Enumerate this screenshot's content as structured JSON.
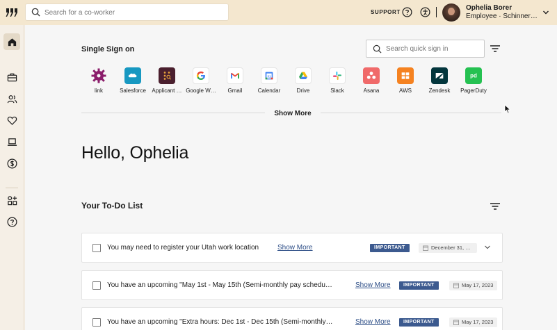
{
  "topbar": {
    "search_placeholder": "Search for a co-worker",
    "support_label": "SUPPORT",
    "user_name": "Ophelia Borer",
    "user_role": "Employee · Schinner…"
  },
  "sidebar": {
    "items": [
      {
        "name": "home",
        "icon": "home-icon",
        "active": true
      },
      {
        "name": "briefcase",
        "icon": "briefcase-icon"
      },
      {
        "name": "people",
        "icon": "people-icon"
      },
      {
        "name": "benefits",
        "icon": "heart-icon"
      },
      {
        "name": "devices",
        "icon": "laptop-icon"
      },
      {
        "name": "payroll",
        "icon": "dollar-icon"
      },
      {
        "name": "apps",
        "icon": "apps-icon"
      },
      {
        "name": "help",
        "icon": "help-icon"
      }
    ]
  },
  "sso": {
    "title": "Single Sign on",
    "search_placeholder": "Search quick sign in",
    "show_more_label": "Show More",
    "apps": [
      {
        "label": "link",
        "icon": "gear-link-icon",
        "color": "#8b1d6b"
      },
      {
        "label": "Salesforce",
        "icon": "salesforce-icon",
        "color": "#1798c1"
      },
      {
        "label": "Applicant …",
        "icon": "applicant-tracking-icon",
        "color": "#4a1f2e"
      },
      {
        "label": "Google W…",
        "icon": "google-icon",
        "color": "#ffffff"
      },
      {
        "label": "Gmail",
        "icon": "gmail-icon",
        "color": "#ffffff"
      },
      {
        "label": "Calendar",
        "icon": "calendar-icon",
        "color": "#ffffff"
      },
      {
        "label": "Drive",
        "icon": "drive-icon",
        "color": "#ffffff"
      },
      {
        "label": "Slack",
        "icon": "slack-icon",
        "color": "#ffffff"
      },
      {
        "label": "Asana",
        "icon": "asana-icon",
        "color": "#f06a6a"
      },
      {
        "label": "AWS",
        "icon": "aws-icon",
        "color": "#f58220"
      },
      {
        "label": "Zendesk",
        "icon": "zendesk-icon",
        "color": "#03363d"
      },
      {
        "label": "PagerDuty",
        "icon": "pagerduty-icon",
        "color": "#25c151"
      }
    ]
  },
  "greeting": "Hello, Ophelia",
  "todo": {
    "title": "Your To-Do List",
    "items": [
      {
        "text": "You may need to register your Utah work location",
        "link": "Show More",
        "badge": "IMPORTANT",
        "date": "December 31, …"
      },
      {
        "text": "You have an upcoming \"May 1st - May 15th (Semi-monthly pay schedu…",
        "link": "Show More",
        "badge": "IMPORTANT",
        "date": "May 17, 2023"
      },
      {
        "text": "You have an upcoming \"Extra hours: Dec 1st - Dec 15th (Semi-monthly…",
        "link": "Show More",
        "badge": "IMPORTANT",
        "date": "May 17, 2023"
      }
    ]
  },
  "colors": {
    "topbar_bg": "#f4e7cf",
    "badge_bg": "#3c5a8f",
    "link": "#2c4d86"
  }
}
